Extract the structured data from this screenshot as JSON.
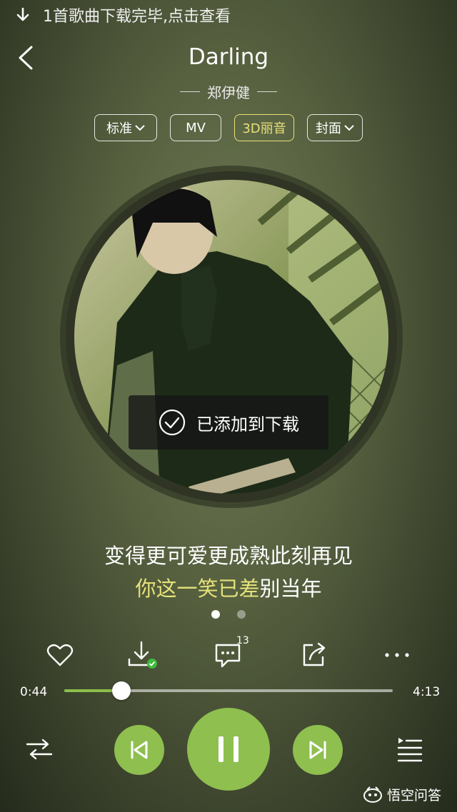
{
  "status_bar": {
    "download_notice": "1首歌曲下载完毕,点击查看",
    "icon": "download-arrow-icon"
  },
  "header": {
    "title": "Darling",
    "artist": "郑伊健"
  },
  "chips": [
    {
      "label": "标准",
      "has_dropdown": true
    },
    {
      "label": "MV",
      "has_dropdown": false
    },
    {
      "label": "3D丽音",
      "has_dropdown": false,
      "highlight": true
    },
    {
      "label": "封面",
      "has_dropdown": true
    }
  ],
  "toast": {
    "text": "已添加到下载",
    "icon": "check-circle-icon"
  },
  "lyrics": {
    "line1": "变得更可爱更成熟此刻再见",
    "line2_sung": "你这一笑已差",
    "line2_rest": "别当年"
  },
  "page_dots": {
    "count": 2,
    "active": 0
  },
  "actions": {
    "like_icon": "heart-icon",
    "download_icon": "download-done-icon",
    "comment_icon": "comment-icon",
    "comment_count": "13",
    "share_icon": "share-icon",
    "more_icon": "more-icon"
  },
  "progress": {
    "current": "0:44",
    "total": "4:13",
    "fraction": 0.174
  },
  "controls": {
    "shuffle_icon": "repeat-order-icon",
    "prev_icon": "previous-icon",
    "play_icon": "pause-icon",
    "next_icon": "next-icon",
    "queue_icon": "playlist-icon"
  },
  "colors": {
    "accent": "#8fbf4f",
    "highlight": "#e6e27a"
  },
  "watermark": "悟空问答"
}
